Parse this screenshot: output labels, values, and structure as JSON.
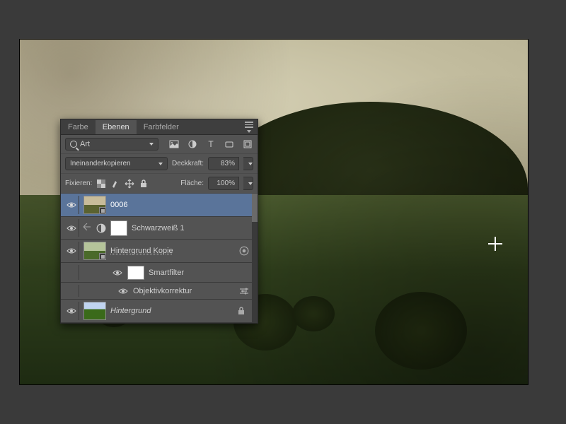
{
  "tabs": {
    "color": "Farbe",
    "layers": "Ebenen",
    "swatches": "Farbfelder"
  },
  "filter": {
    "placeholder": "Art"
  },
  "blend": {
    "mode": "Ineinanderkopieren",
    "opacity_label": "Deckkraft:",
    "opacity_value": "83%"
  },
  "lock": {
    "label": "Fixieren:",
    "fill_label": "Fläche:",
    "fill_value": "100%"
  },
  "layers": [
    {
      "name": "0006",
      "selected": true,
      "thumb": "tex"
    },
    {
      "name": "Schwarzweiß 1",
      "adjustment": true
    },
    {
      "name": "Hintergrund Kopie",
      "thumb": "img",
      "smart": true
    },
    {
      "name": "Smartfilter",
      "child": true
    },
    {
      "name": "Objektivkorrektur",
      "filter": true
    },
    {
      "name": "Hintergrund",
      "thumb": "img2",
      "locked": true,
      "italic": true
    }
  ]
}
